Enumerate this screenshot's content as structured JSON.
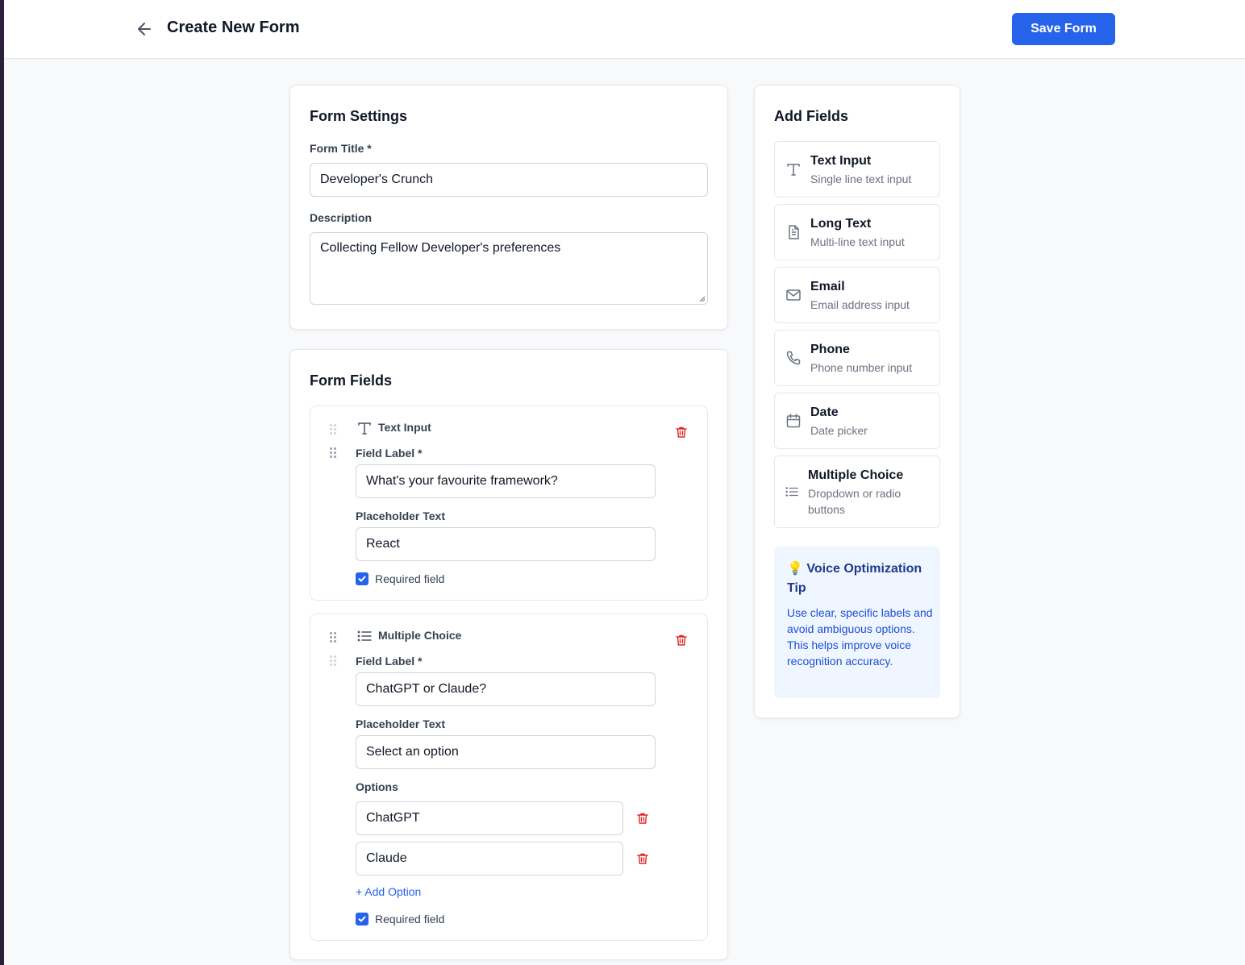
{
  "header": {
    "title": "Create New Form",
    "save_label": "Save Form"
  },
  "settings": {
    "heading": "Form Settings",
    "title_label": "Form Title *",
    "title_value": "Developer's Crunch",
    "description_label": "Description",
    "description_value": "Collecting Fellow Developer's preferences"
  },
  "fields_section": {
    "heading": "Form Fields",
    "fields": [
      {
        "type": "Text Input",
        "field_label_caption": "Field Label *",
        "field_label_value": "What's your favourite framework?",
        "placeholder_caption": "Placeholder Text",
        "placeholder_value": "React",
        "required_label": "Required field",
        "required": true
      },
      {
        "type": "Multiple Choice",
        "field_label_caption": "Field Label *",
        "field_label_value": "ChatGPT or Claude?",
        "placeholder_caption": "Placeholder Text",
        "placeholder_value": "Select an option",
        "options_caption": "Options",
        "options": [
          "ChatGPT",
          "Claude"
        ],
        "add_option_label": "+ Add Option",
        "required_label": "Required field",
        "required": true
      }
    ]
  },
  "palette": {
    "heading": "Add Fields",
    "items": [
      {
        "name": "Text Input",
        "desc": "Single line text input",
        "icon": "text-icon"
      },
      {
        "name": "Long Text",
        "desc": "Multi-line text input",
        "icon": "document-icon"
      },
      {
        "name": "Email",
        "desc": "Email address input",
        "icon": "mail-icon"
      },
      {
        "name": "Phone",
        "desc": "Phone number input",
        "icon": "phone-icon"
      },
      {
        "name": "Date",
        "desc": "Date picker",
        "icon": "calendar-icon"
      },
      {
        "name": "Multiple Choice",
        "desc": "Dropdown or radio buttons",
        "icon": "list-icon"
      }
    ],
    "tip": {
      "title": "💡 Voice Optimization Tip",
      "text": "Use clear, specific labels and avoid ambiguous options. This helps improve voice recognition accuracy."
    }
  },
  "colors": {
    "accent": "#2563eb",
    "danger": "#dc2626",
    "tip_bg": "#eff6ff"
  }
}
